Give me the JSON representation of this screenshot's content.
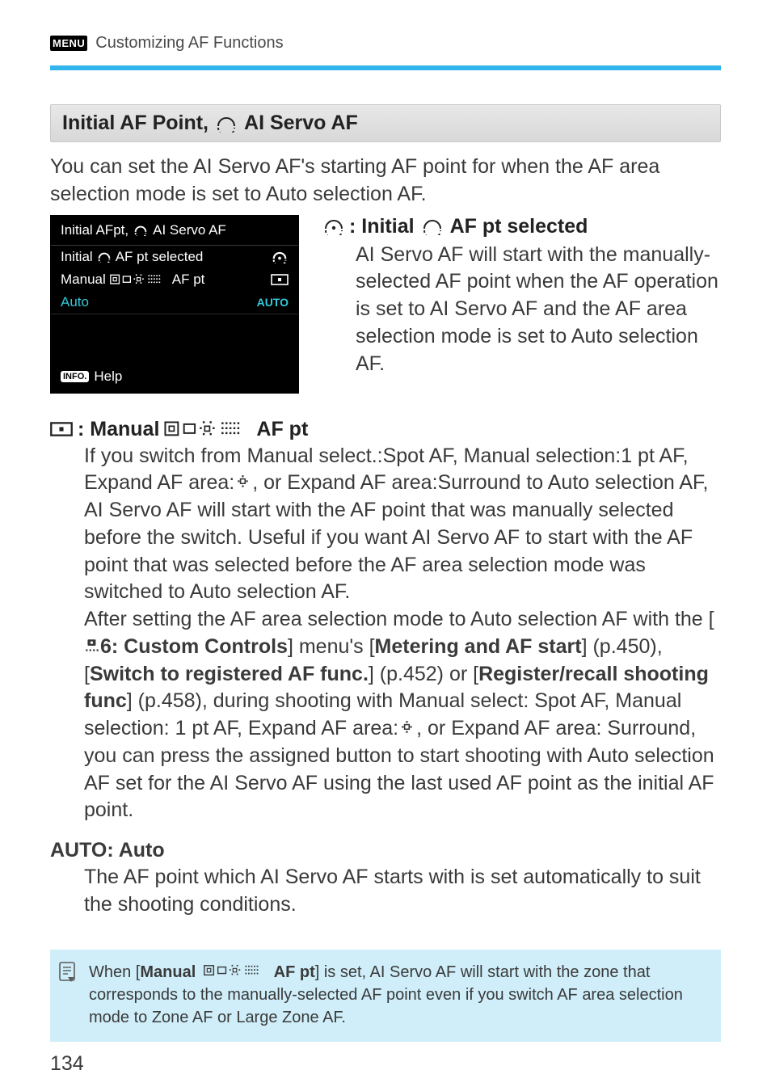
{
  "crumb": {
    "menu_badge": "MENU",
    "text": "Customizing AF Functions"
  },
  "heading": {
    "part1": "Initial AF Point,",
    "part2": "AI Servo AF"
  },
  "intro": "You can set the AI Servo AF's starting AF point for when the AF area selection mode is set to Auto selection AF.",
  "lcd": {
    "title_prefix": "Initial AFpt,",
    "title_suffix": "AI Servo AF",
    "row1_label_prefix": "Initial",
    "row1_label_suffix": "AF pt selected",
    "row2_label_prefix": "Manual",
    "row2_label_suffix": "AF pt",
    "row3_label": "Auto",
    "row3_value": "AUTO",
    "help_badge": "INFO.",
    "help_text": "Help"
  },
  "opt1": {
    "head_prefix": ": Initial",
    "head_suffix": "AF pt selected",
    "body": "AI Servo AF will start with the manually-selected AF point when the AF operation is set to AI Servo AF and the AF area selection mode is set to Auto selection AF."
  },
  "opt2": {
    "head_prefix": ": Manual",
    "head_suffix": "AF pt",
    "body_p1": "If you switch from Manual select.:Spot AF, Manual selection:1 pt AF, Expand AF area:",
    "body_p1b": ", or Expand AF area:Surround to Auto selection AF, AI Servo AF will start with the AF point that was manually selected before the switch. Useful if you want AI Servo AF to start with the AF point that was selected before the AF area selection mode was switched to Auto selection AF.",
    "body_p2a": "After setting the AF area selection mode to Auto selection AF with the [",
    "body_p2_bold1": "6: Custom Controls",
    "body_p2b": "] menu's [",
    "body_p2_bold2": "Metering and AF start",
    "body_p2c": "] (p.450), [",
    "body_p2_bold3": "Switch to registered AF func.",
    "body_p2d": "] (p.452) or [",
    "body_p2_bold4": "Register/recall shooting func",
    "body_p2e": "] (p.458), during shooting with Manual select: Spot AF, Manual selection: 1 pt AF, Expand AF area:",
    "body_p2f": ", or Expand AF area: Surround, you can press the assigned button to start shooting with Auto selection AF set for the AI Servo AF using the last used AF point as the initial AF point."
  },
  "opt3": {
    "head": "AUTO: Auto",
    "body": "The AF point which AI Servo AF starts with is set automatically to suit the shooting conditions."
  },
  "note": {
    "p1a": "When [",
    "p1_bold_prefix": "Manual",
    "p1_bold_suffix": "AF pt",
    "p1b": "] is set, AI Servo AF will start with the zone that corresponds to the manually-selected AF point even if you switch AF area selection mode to Zone AF or Large Zone AF."
  },
  "page_number": "134"
}
